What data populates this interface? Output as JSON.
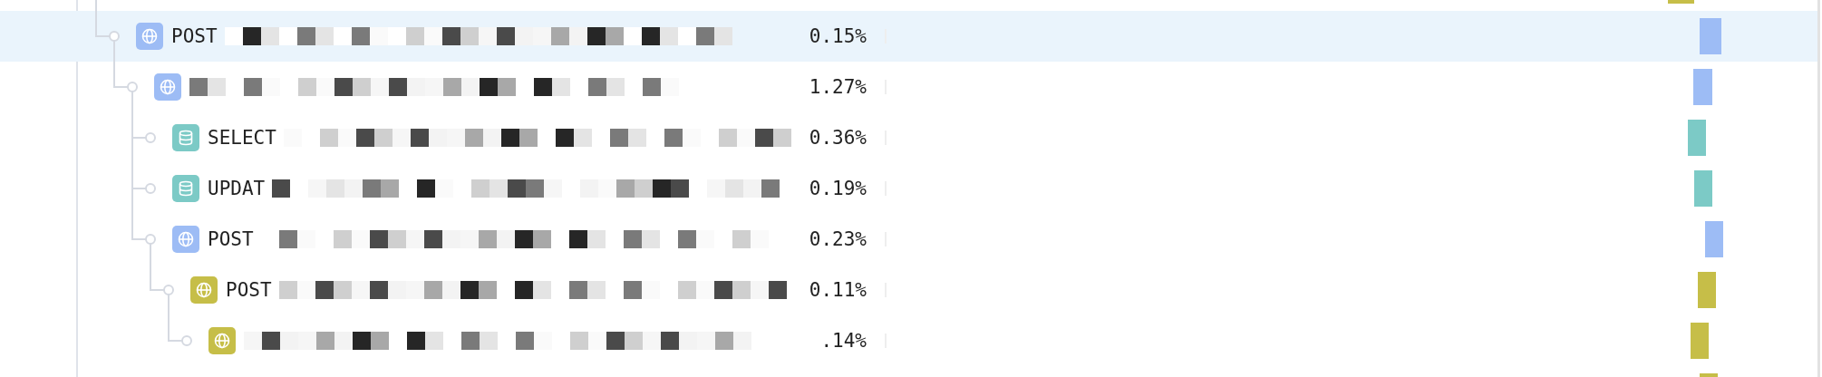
{
  "rows": [
    {
      "kind": "cut",
      "color": "#c6be48"
    },
    {
      "kind": "http",
      "color": "#9dbcf5",
      "method": "POST",
      "percent": "0.15%",
      "selected": true,
      "children": [
        {
          "kind": "http",
          "color": "#9dbcf5",
          "percent": "1.27%",
          "selected": false,
          "children": [
            {
              "kind": "db",
              "color": "#7ccac6",
              "method": "SELECT",
              "percent": "0.36%",
              "selected": false
            },
            {
              "kind": "db",
              "color": "#7ccac6",
              "method": "UPDAT",
              "percent": "0.19%",
              "selected": false
            },
            {
              "kind": "http",
              "color": "#9dbcf5",
              "method": "POST",
              "percent": "0.23%",
              "selected": false,
              "children": [
                {
                  "kind": "http",
                  "color": "#c6be48",
                  "method": "POST",
                  "percent": "0.11%",
                  "selected": false,
                  "children": [
                    {
                      "kind": "http",
                      "color": "#c6be48",
                      "percent": ".14%",
                      "selected": false
                    }
                  ]
                }
              ]
            }
          ]
        }
      ]
    },
    {
      "kind": "cut",
      "color": "#c6be48"
    }
  ]
}
